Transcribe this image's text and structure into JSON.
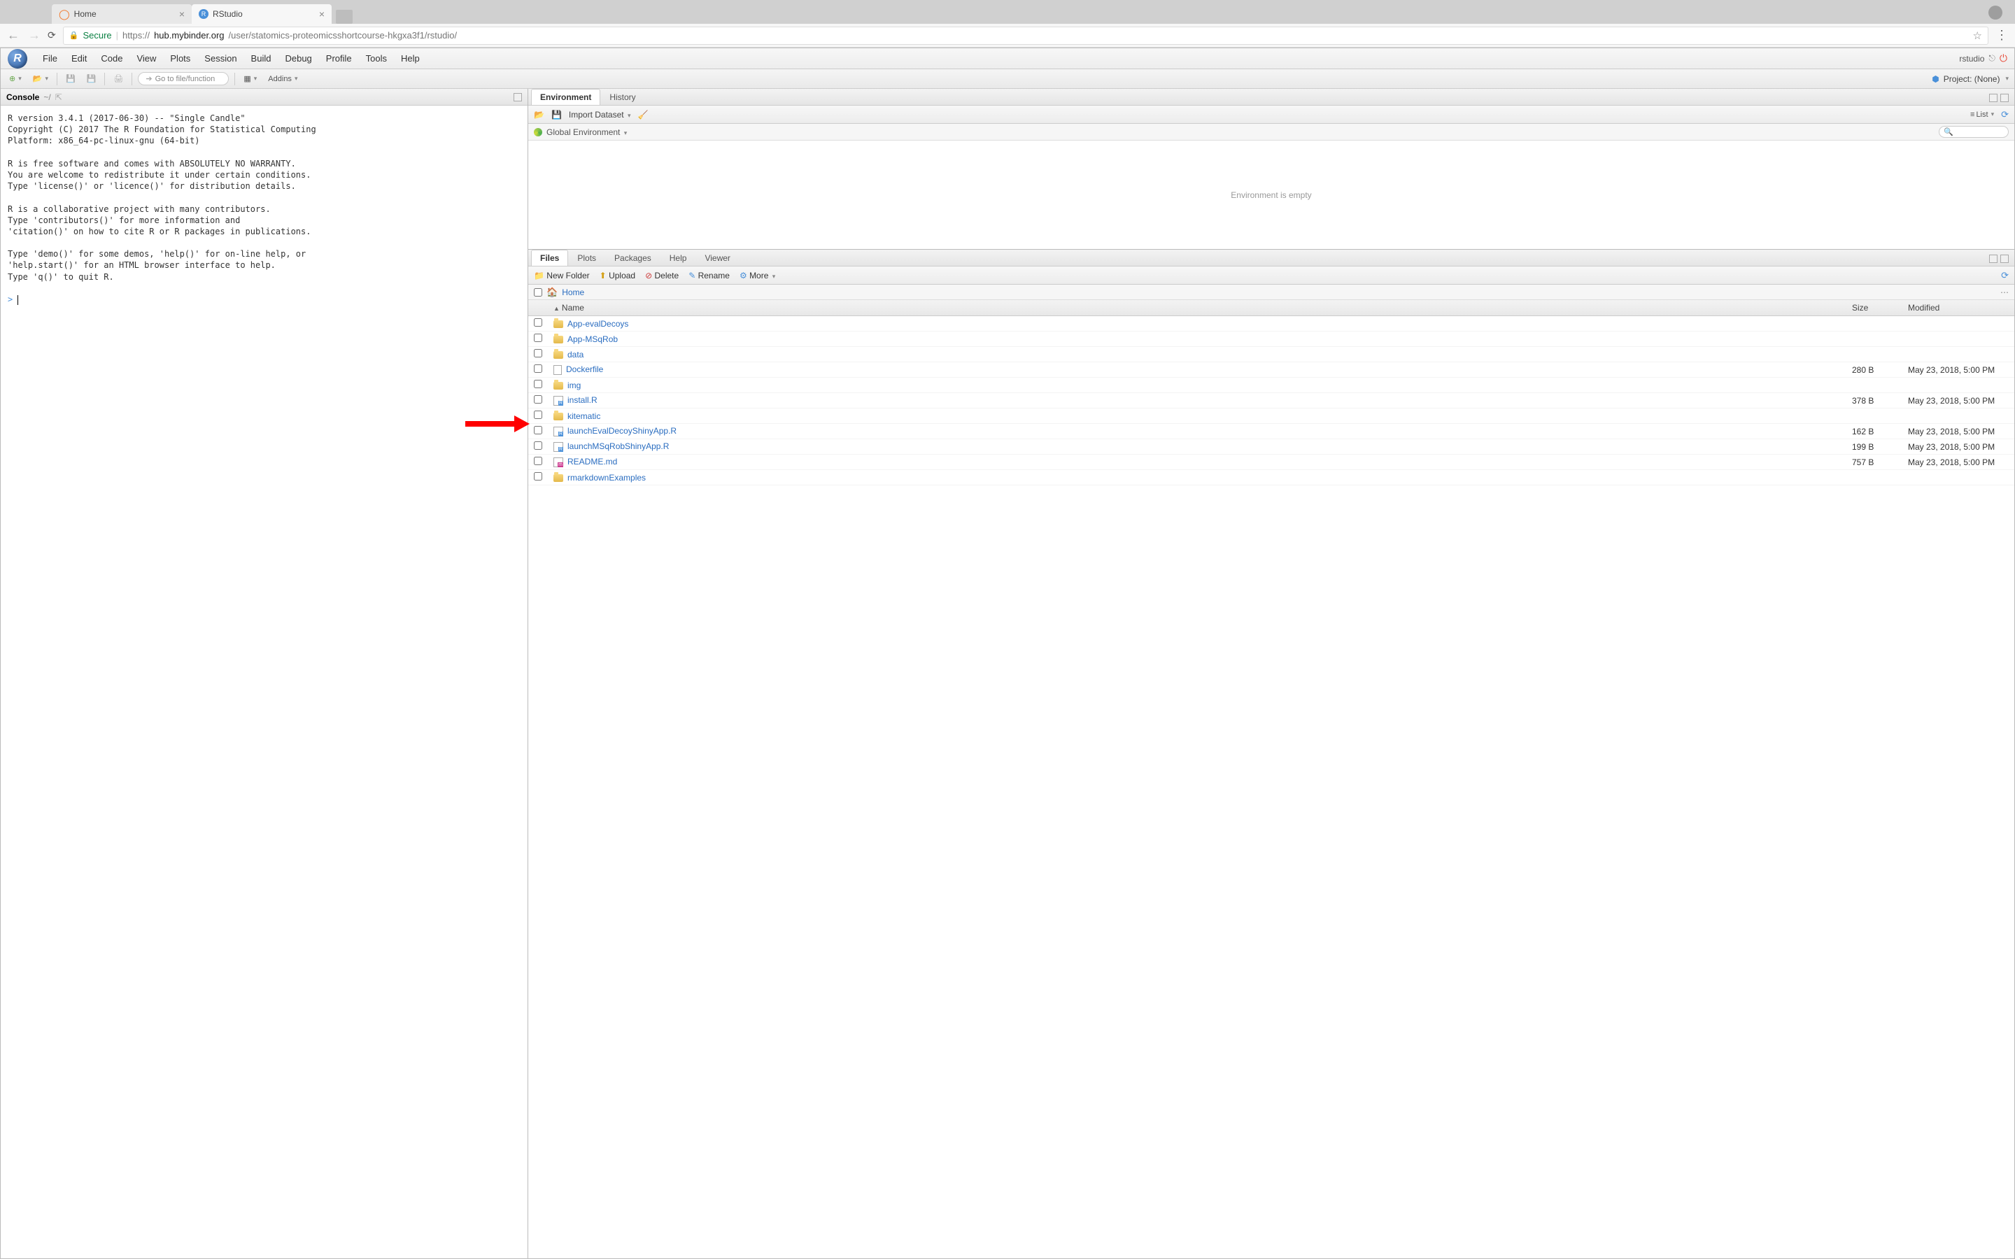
{
  "browser": {
    "tabs": [
      {
        "label": "Home",
        "active": false
      },
      {
        "label": "RStudio",
        "active": true
      }
    ],
    "back": "←",
    "forward": "→",
    "reload": "⟳",
    "secure_label": "Secure",
    "url_proto": "https://",
    "url_host": "hub.mybinder.org",
    "url_path": "/user/statomics-proteomicsshortcourse-hkgxa3f1/rstudio/"
  },
  "rstudio": {
    "menus": [
      "File",
      "Edit",
      "Code",
      "View",
      "Plots",
      "Session",
      "Build",
      "Debug",
      "Profile",
      "Tools",
      "Help"
    ],
    "user_label": "rstudio",
    "goto_placeholder": "Go to file/function",
    "addins_label": "Addins",
    "project_label": "Project: (None)"
  },
  "console": {
    "title": "Console",
    "path": "~/",
    "body": "R version 3.4.1 (2017-06-30) -- \"Single Candle\"\nCopyright (C) 2017 The R Foundation for Statistical Computing\nPlatform: x86_64-pc-linux-gnu (64-bit)\n\nR is free software and comes with ABSOLUTELY NO WARRANTY.\nYou are welcome to redistribute it under certain conditions.\nType 'license()' or 'licence()' for distribution details.\n\nR is a collaborative project with many contributors.\nType 'contributors()' for more information and\n'citation()' on how to cite R or R packages in publications.\n\nType 'demo()' for some demos, 'help()' for on-line help, or\n'help.start()' for an HTML browser interface to help.\nType 'q()' to quit R.\n",
    "prompt": ">"
  },
  "env": {
    "tabs": [
      "Environment",
      "History"
    ],
    "import_label": "Import Dataset",
    "list_label": "List",
    "scope_label": "Global Environment",
    "empty_msg": "Environment is empty"
  },
  "files_pane": {
    "tabs": [
      "Files",
      "Plots",
      "Packages",
      "Help",
      "Viewer"
    ],
    "toolbar": {
      "new_folder": "New Folder",
      "upload": "Upload",
      "delete": "Delete",
      "rename": "Rename",
      "more": "More"
    },
    "breadcrumb": "Home",
    "columns": {
      "name": "Name",
      "size": "Size",
      "modified": "Modified"
    },
    "rows": [
      {
        "icon": "folder",
        "name": "App-evalDecoys",
        "size": "",
        "modified": ""
      },
      {
        "icon": "folder",
        "name": "App-MSqRob",
        "size": "",
        "modified": ""
      },
      {
        "icon": "folder",
        "name": "data",
        "size": "",
        "modified": ""
      },
      {
        "icon": "doc",
        "name": "Dockerfile",
        "size": "280 B",
        "modified": "May 23, 2018, 5:00 PM"
      },
      {
        "icon": "folder",
        "name": "img",
        "size": "",
        "modified": ""
      },
      {
        "icon": "r",
        "name": "install.R",
        "size": "378 B",
        "modified": "May 23, 2018, 5:00 PM"
      },
      {
        "icon": "folder",
        "name": "kitematic",
        "size": "",
        "modified": ""
      },
      {
        "icon": "r",
        "name": "launchEvalDecoyShinyApp.R",
        "size": "162 B",
        "modified": "May 23, 2018, 5:00 PM"
      },
      {
        "icon": "r",
        "name": "launchMSqRobShinyApp.R",
        "size": "199 B",
        "modified": "May 23, 2018, 5:00 PM"
      },
      {
        "icon": "md",
        "name": "README.md",
        "size": "757 B",
        "modified": "May 23, 2018, 5:00 PM"
      },
      {
        "icon": "folder",
        "name": "rmarkdownExamples",
        "size": "",
        "modified": ""
      }
    ]
  }
}
